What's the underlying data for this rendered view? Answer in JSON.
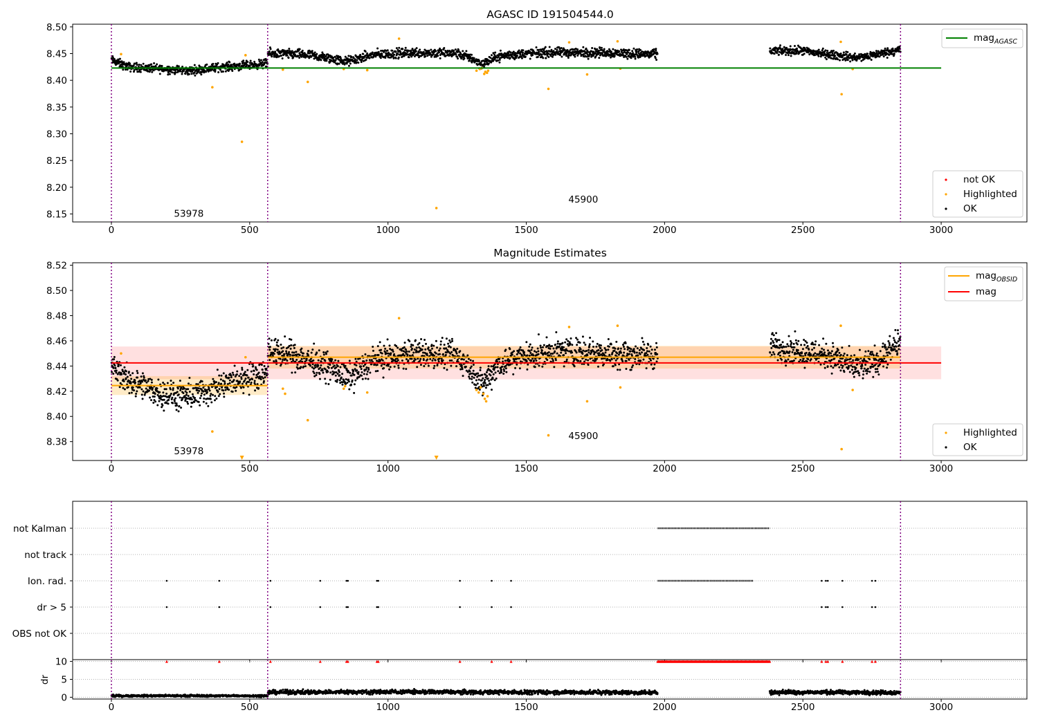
{
  "chart_data": [
    {
      "type": "scatter",
      "title": "AGASC ID 191504544.0",
      "xlim": [
        -140,
        3310
      ],
      "ylim": [
        8.135,
        8.505
      ],
      "xticks": [
        0,
        500,
        1000,
        1500,
        2000,
        2500,
        3000
      ],
      "yticks": [
        8.15,
        8.2,
        8.25,
        8.3,
        8.35,
        8.4,
        8.45,
        8.5
      ],
      "ytick_labels": [
        "8.15",
        "8.20",
        "8.25",
        "8.30",
        "8.35",
        "8.40",
        "8.45",
        "8.50"
      ],
      "obs_boundaries": [
        0,
        565,
        2853
      ],
      "obs_labels": [
        {
          "x": 280,
          "y": 8.145,
          "text": "53978"
        },
        {
          "x": 1706,
          "y": 8.171,
          "text": "45900"
        }
      ],
      "hlines": [
        {
          "name": "mag_AGASC",
          "label_main": "mag",
          "label_sub": "AGASC",
          "y": 8.423,
          "xmin": 0,
          "xmax": 3000,
          "color": "#008000"
        }
      ],
      "legend_lines": [
        {
          "label_main": "mag",
          "label_sub": "AGASC",
          "color": "#008000"
        }
      ],
      "legend_points": [
        {
          "label": "not OK",
          "color": "#ff0000"
        },
        {
          "label": "Highlighted",
          "color": "#ffa500"
        },
        {
          "label": "OK",
          "color": "#000000"
        }
      ],
      "series": [
        {
          "name": "OK",
          "color": "#000000",
          "segments": [
            {
              "x0": 0,
              "x1": 565,
              "anchors": [
                [
                  0,
                  8.438
                ],
                [
                  60,
                  8.425
                ],
                [
                  200,
                  8.421
                ],
                [
                  280,
                  8.418
                ],
                [
                  400,
                  8.425
                ],
                [
                  500,
                  8.428
                ],
                [
                  565,
                  8.432
                ]
              ],
              "spread": 0.008
            },
            {
              "x0": 565,
              "x1": 1975,
              "anchors": [
                [
                  565,
                  8.45
                ],
                [
                  700,
                  8.448
                ],
                [
                  800,
                  8.44
                ],
                [
                  850,
                  8.435
                ],
                [
                  950,
                  8.448
                ],
                [
                  1100,
                  8.452
                ],
                [
                  1250,
                  8.45
                ],
                [
                  1300,
                  8.442
                ],
                [
                  1340,
                  8.43
                ],
                [
                  1400,
                  8.445
                ],
                [
                  1500,
                  8.45
                ],
                [
                  1600,
                  8.452
                ],
                [
                  1800,
                  8.452
                ],
                [
                  1975,
                  8.448
                ]
              ],
              "spread": 0.009
            },
            {
              "x0": 2380,
              "x1": 2853,
              "anchors": [
                [
                  2380,
                  8.455
                ],
                [
                  2500,
                  8.455
                ],
                [
                  2600,
                  8.448
                ],
                [
                  2700,
                  8.442
                ],
                [
                  2800,
                  8.452
                ],
                [
                  2853,
                  8.458
                ]
              ],
              "spread": 0.008
            }
          ]
        },
        {
          "name": "Highlighted",
          "color": "#ffa500",
          "points": [
            [
              35,
              8.449
            ],
            [
              365,
              8.387
            ],
            [
              472,
              8.285
            ],
            [
              485,
              8.447
            ],
            [
              620,
              8.42
            ],
            [
              710,
              8.397
            ],
            [
              840,
              8.421
            ],
            [
              925,
              8.419
            ],
            [
              1040,
              8.478
            ],
            [
              1175,
              8.161
            ],
            [
              1320,
              8.418
            ],
            [
              1332,
              8.421
            ],
            [
              1340,
              8.423
            ],
            [
              1348,
              8.412
            ],
            [
              1352,
              8.416
            ],
            [
              1358,
              8.414
            ],
            [
              1362,
              8.418
            ],
            [
              1580,
              8.384
            ],
            [
              1655,
              8.471
            ],
            [
              1720,
              8.411
            ],
            [
              1830,
              8.473
            ],
            [
              1840,
              8.422
            ],
            [
              2637,
              8.472
            ],
            [
              2640,
              8.374
            ],
            [
              2680,
              8.421
            ]
          ]
        }
      ]
    },
    {
      "type": "scatter",
      "title": "Magnitude Estimates",
      "xlim": [
        -140,
        3310
      ],
      "ylim": [
        8.365,
        8.522
      ],
      "xticks": [
        0,
        500,
        1000,
        1500,
        2000,
        2500,
        3000
      ],
      "yticks": [
        8.38,
        8.4,
        8.42,
        8.44,
        8.46,
        8.48,
        8.5,
        8.52
      ],
      "ytick_labels": [
        "8.38",
        "8.40",
        "8.42",
        "8.44",
        "8.46",
        "8.48",
        "8.50",
        "8.52"
      ],
      "obs_boundaries": [
        0,
        565,
        2853
      ],
      "obs_labels": [
        {
          "x": 280,
          "y": 8.37,
          "text": "53978"
        },
        {
          "x": 1706,
          "y": 8.382,
          "text": "45900"
        }
      ],
      "bands": [
        {
          "name": "mag",
          "xmin": 0,
          "xmax": 3000,
          "ymin": 8.4295,
          "ymax": 8.4555,
          "color": "#ff0000",
          "opacity": 0.12
        },
        {
          "name": "mag_OBSID 53978",
          "xmin": 0,
          "xmax": 565,
          "ymin": 8.417,
          "ymax": 8.432,
          "color": "#ffa500",
          "opacity": 0.22
        },
        {
          "name": "mag_OBSID 45900",
          "xmin": 565,
          "xmax": 2853,
          "ymin": 8.438,
          "ymax": 8.456,
          "color": "#ffa500",
          "opacity": 0.22
        }
      ],
      "hlines": [
        {
          "name": "mag_OBSID 53978",
          "y": 8.4245,
          "xmin": 0,
          "xmax": 565,
          "color": "#ffa500"
        },
        {
          "name": "mag_OBSID 45900",
          "y": 8.447,
          "xmin": 565,
          "xmax": 2853,
          "color": "#ffa500"
        },
        {
          "name": "mag",
          "y": 8.4425,
          "xmin": 0,
          "xmax": 3000,
          "color": "#ff0000"
        }
      ],
      "legend_lines": [
        {
          "label_main": "mag",
          "label_sub": "OBSID",
          "color": "#ffa500"
        },
        {
          "label_main": "mag",
          "label_sub": "",
          "color": "#ff0000"
        }
      ],
      "legend_points": [
        {
          "label": "Highlighted",
          "color": "#ffa500"
        },
        {
          "label": "OK",
          "color": "#000000"
        }
      ],
      "series": [
        {
          "name": "OK",
          "color": "#000000",
          "segments": [
            {
              "x0": 0,
              "x1": 565,
              "anchors": [
                [
                  0,
                  8.44
                ],
                [
                  50,
                  8.43
                ],
                [
                  150,
                  8.42
                ],
                [
                  250,
                  8.415
                ],
                [
                  350,
                  8.42
                ],
                [
                  450,
                  8.428
                ],
                [
                  520,
                  8.433
                ],
                [
                  565,
                  8.435
                ]
              ],
              "spread": 0.011
            },
            {
              "x0": 565,
              "x1": 1975,
              "anchors": [
                [
                  565,
                  8.452
                ],
                [
                  700,
                  8.446
                ],
                [
                  800,
                  8.438
                ],
                [
                  850,
                  8.43
                ],
                [
                  950,
                  8.445
                ],
                [
                  1100,
                  8.45
                ],
                [
                  1250,
                  8.448
                ],
                [
                  1300,
                  8.438
                ],
                [
                  1340,
                  8.425
                ],
                [
                  1400,
                  8.442
                ],
                [
                  1500,
                  8.448
                ],
                [
                  1650,
                  8.452
                ],
                [
                  1800,
                  8.45
                ],
                [
                  1975,
                  8.448
                ]
              ],
              "spread": 0.011
            },
            {
              "x0": 2380,
              "x1": 2853,
              "anchors": [
                [
                  2380,
                  8.455
                ],
                [
                  2500,
                  8.452
                ],
                [
                  2600,
                  8.448
                ],
                [
                  2700,
                  8.438
                ],
                [
                  2800,
                  8.448
                ],
                [
                  2853,
                  8.46
                ]
              ],
              "spread": 0.011
            }
          ]
        },
        {
          "name": "Highlighted",
          "color": "#ffa500",
          "points": [
            [
              35,
              8.45
            ],
            [
              365,
              8.388
            ],
            [
              485,
              8.447
            ],
            [
              620,
              8.422
            ],
            [
              628,
              8.418
            ],
            [
              710,
              8.397
            ],
            [
              840,
              8.422
            ],
            [
              845,
              8.424
            ],
            [
              925,
              8.419
            ],
            [
              1040,
              8.478
            ],
            [
              1320,
              8.421
            ],
            [
              1328,
              8.419
            ],
            [
              1335,
              8.423
            ],
            [
              1345,
              8.418
            ],
            [
              1350,
              8.414
            ],
            [
              1355,
              8.412
            ],
            [
              1360,
              8.416
            ],
            [
              1580,
              8.385
            ],
            [
              1655,
              8.471
            ],
            [
              1720,
              8.412
            ],
            [
              1830,
              8.472
            ],
            [
              1840,
              8.423
            ],
            [
              2637,
              8.472
            ],
            [
              2640,
              8.374
            ],
            [
              2680,
              8.421
            ]
          ]
        },
        {
          "name": "Highlighted (off scale)",
          "color": "#ffa500",
          "points": [
            [
              472,
              8.366
            ],
            [
              1175,
              8.366
            ]
          ]
        }
      ]
    },
    {
      "type": "scatter",
      "title": "",
      "xlim": [
        -140,
        3310
      ],
      "categories": [
        "not Kalman",
        "not track",
        "Ion. rad.",
        "dr > 5",
        "OBS not OK"
      ],
      "flag_ticks": [
        {
          "x": 1975,
          "x1": 2380,
          "row": "not Kalman"
        }
      ],
      "flag_points": {
        "Ion. rad.": [
          200,
          390,
          575,
          755,
          850,
          855,
          960,
          965,
          1260,
          1375,
          1445,
          2568,
          2583,
          2590,
          2643,
          2750,
          2762
        ],
        "dr > 5": [
          200,
          390,
          575,
          755,
          850,
          855,
          960,
          965,
          1260,
          1375,
          1445,
          2568,
          2583,
          2590,
          2643,
          2750,
          2762
        ]
      },
      "flag_runs": {
        "not Kalman": [
          [
            1975,
            2380
          ]
        ],
        "Ion. rad.": [
          [
            1975,
            2320
          ]
        ],
        "dr > 5": []
      },
      "obs_boundaries": [
        0,
        565,
        2853
      ]
    },
    {
      "type": "scatter",
      "title": "",
      "ylabel": "dr",
      "xlim": [
        -140,
        3310
      ],
      "ylim": [
        -0.5,
        10.5
      ],
      "xticks": [
        0,
        500,
        1000,
        1500,
        2000,
        2500,
        3000
      ],
      "yticks": [
        0,
        5,
        10
      ],
      "ytick_labels": [
        "0",
        "5",
        "10"
      ],
      "obs_boundaries": [
        0,
        565,
        2853
      ],
      "clip_points_x": [
        200,
        390,
        575,
        755,
        850,
        855,
        960,
        965,
        1260,
        1375,
        1445,
        2568,
        2583,
        2590,
        2643,
        2750,
        2762
      ],
      "clip_run": [
        1975,
        2380
      ],
      "clip_y": 10,
      "series": [
        {
          "name": "dr",
          "color": "#000000",
          "segments": [
            {
              "x0": 0,
              "x1": 565,
              "anchors": [
                [
                  0,
                  0.4
                ],
                [
                  565,
                  0.4
                ]
              ],
              "spread": 0.3
            },
            {
              "x0": 565,
              "x1": 1975,
              "anchors": [
                [
                  565,
                  1.4
                ],
                [
                  1000,
                  1.5
                ],
                [
                  1500,
                  1.4
                ],
                [
                  1975,
                  1.3
                ]
              ],
              "spread": 0.6
            },
            {
              "x0": 2380,
              "x1": 2853,
              "anchors": [
                [
                  2380,
                  1.4
                ],
                [
                  2853,
                  1.3
                ]
              ],
              "spread": 0.6
            }
          ]
        }
      ]
    }
  ]
}
